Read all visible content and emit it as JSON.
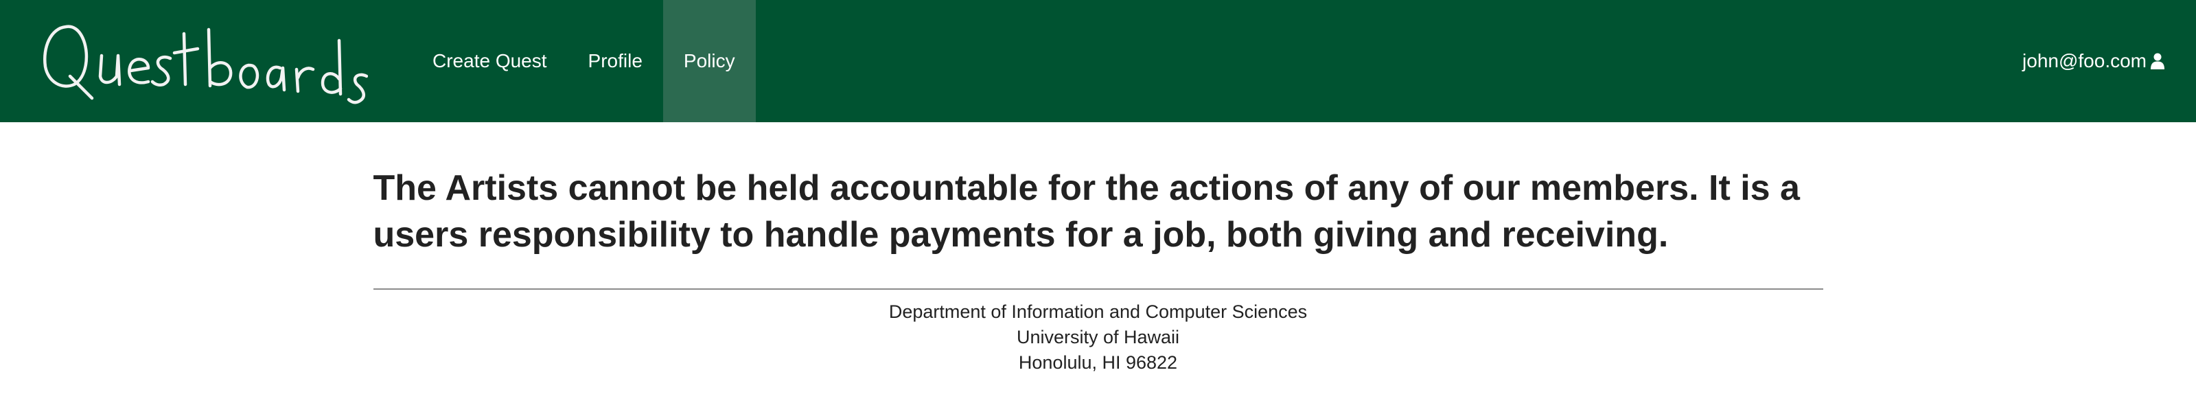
{
  "navbar": {
    "logo_text": "Questboards",
    "items": [
      {
        "label": "Create Quest",
        "active": false
      },
      {
        "label": "Profile",
        "active": false
      },
      {
        "label": "Policy",
        "active": true
      }
    ],
    "user": {
      "email": "john@foo.com",
      "icon": "user-icon"
    },
    "colors": {
      "background": "#005331",
      "active_item": "#2c6a50",
      "text": "#ffffff"
    }
  },
  "main": {
    "policy_text": "The Artists cannot be held accountable for the actions of any of our members. It is a users responsibility to handle payments for a job, both giving and receiving."
  },
  "footer": {
    "lines": [
      "Department of Information and Computer Sciences",
      "University of Hawaii",
      "Honolulu, HI 96822"
    ]
  }
}
